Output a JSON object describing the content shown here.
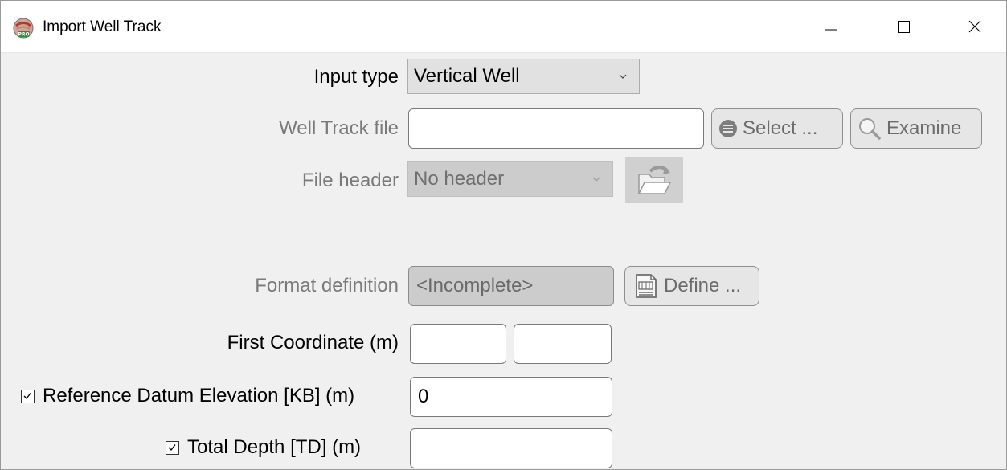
{
  "window": {
    "title": "Import Well Track",
    "app_icon_badge": "PRO"
  },
  "form": {
    "input_type": {
      "label": "Input type",
      "value": "Vertical Well"
    },
    "well_track_file": {
      "label": "Well Track file",
      "value": "",
      "select_button": "Select ...",
      "examine_button": "Examine"
    },
    "file_header": {
      "label": "File header",
      "value": "No header"
    },
    "format_definition": {
      "label": "Format definition",
      "value": "<Incomplete>",
      "define_button": "Define ..."
    },
    "first_coordinate": {
      "label": "First Coordinate (m)",
      "x_value": "",
      "y_value": ""
    },
    "reference_datum": {
      "label": "Reference Datum Elevation [KB] (m)",
      "checked": true,
      "value": "0"
    },
    "total_depth": {
      "label": "Total Depth [TD] (m)",
      "checked": true,
      "value": ""
    }
  },
  "icons": {
    "app": "well-track-pro-icon",
    "minimize": "minimize-icon",
    "maximize": "maximize-icon",
    "close": "close-icon",
    "select": "list-circle-icon",
    "examine": "magnifier-icon",
    "open_header": "open-folder-icon",
    "define": "document-format-icon",
    "combo_arrow": "chevron-down-icon"
  }
}
